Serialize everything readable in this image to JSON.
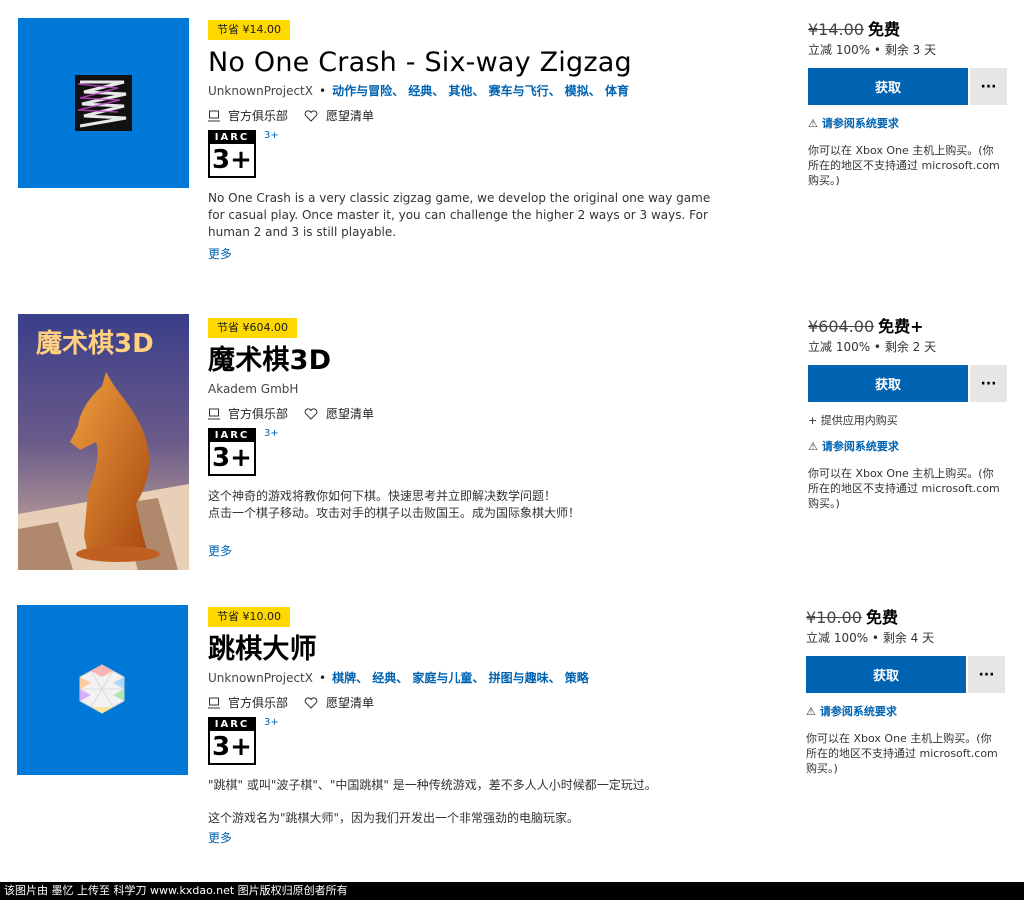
{
  "products": [
    {
      "badge": "节省 ¥14.00",
      "title": "No One Crash - Six-way Zigzag",
      "publisher": "UnknownProjectX",
      "categories": "动作与冒险、 经典、 其他、 赛车与飞行、 模拟、 体育",
      "club": "官方俱乐部",
      "wishlist": "愿望清单",
      "iarc": "IARC",
      "age": "3+",
      "age_link": "3+",
      "description": "No One Crash is a very classic zigzag game, we develop the original one way game for casual play. Once master it, you can challenge the higher 2 ways or 3 ways. For human 2 and 3 is still playable.",
      "more": "更多",
      "old_price": "¥14.00",
      "new_price": "免费",
      "discount": "立减 100% • 剩余 3 天",
      "get": "获取",
      "more_btn": "···",
      "sysreq": "请参阅系统要求",
      "avail": "你可以在 Xbox One 主机上购买。(你所在的地区不支持通过 microsoft.com 购买。)"
    },
    {
      "badge": "节省 ¥604.00",
      "title": "魔术棋3D",
      "publisher": "Akadem GmbH",
      "club": "官方俱乐部",
      "wishlist": "愿望清单",
      "iarc": "IARC",
      "age": "3+",
      "age_link": "3+",
      "description": "这个神奇的游戏将教你如何下棋。快速思考并立即解决数学问题！\n点击一个棋子移动。攻击对手的棋子以击败国王。成为国际象棋大师！",
      "more": "更多",
      "thumb_text": "魔术棋3D",
      "old_price": "¥604.00",
      "new_price": "免费+",
      "discount": "立减 100% • 剩余 2 天",
      "get": "获取",
      "more_btn": "···",
      "iap": "+ 提供应用内购买",
      "sysreq": "请参阅系统要求",
      "avail": "你可以在 Xbox One 主机上购买。(你所在的地区不支持通过 microsoft.com 购买。)"
    },
    {
      "badge": "节省 ¥10.00",
      "title": "跳棋大师",
      "publisher": "UnknownProjectX",
      "categories": "棋牌、 经典、 家庭与儿童、 拼图与趣味、 策略",
      "club": "官方俱乐部",
      "wishlist": "愿望清单",
      "iarc": "IARC",
      "age": "3+",
      "age_link": "3+",
      "description1": "\"跳棋\" 或叫\"波子棋\"、\"中国跳棋\" 是一种传统游戏，差不多人人小时候都一定玩过。",
      "description2": "这个游戏名为\"跳棋大师\"，因为我们开发出一个非常强劲的电脑玩家。",
      "more": "更多",
      "old_price": "¥10.00",
      "new_price": "免费",
      "discount": "立减 100% • 剩余 4 天",
      "get": "获取",
      "more_btn": "···",
      "sysreq": "请参阅系统要求",
      "avail": "你可以在 Xbox One 主机上购买。(你所在的地区不支持通过 microsoft.com 购买。)"
    }
  ],
  "footer": "该图片由 墨忆 上传至 科学刀 www.kxdao.net 图片版权归原创者所有",
  "colors": {
    "accent": "#0063b1",
    "tile": "#0078d7",
    "badge": "#ffd800"
  }
}
